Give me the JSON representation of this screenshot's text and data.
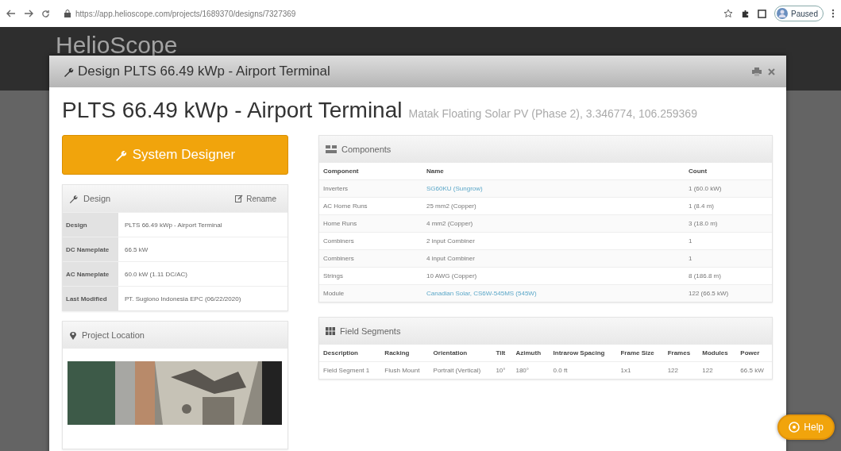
{
  "browser": {
    "url": "https://app.helioscope.com/projects/1689370/designs/7327369",
    "profile": "Paused"
  },
  "app_header": {
    "logo": "HelioScope"
  },
  "modal": {
    "title": "Design PLTS 66.49 kWp - Airport Terminal"
  },
  "heading": {
    "title": "PLTS 66.49 kWp - Airport Terminal",
    "subtitle": "Matak Floating Solar PV (Phase 2), 3.346774, 106.259369"
  },
  "system_designer_button": "System Designer",
  "design_panel": {
    "title": "Design",
    "rename_button": "Rename",
    "rows": [
      {
        "label": "Design",
        "value": "PLTS 66.49 kWp - Airport Terminal"
      },
      {
        "label": "DC Nameplate",
        "value": "66.5 kW"
      },
      {
        "label": "AC Nameplate",
        "value": "60.0 kW (1.11 DC/AC)"
      },
      {
        "label": "Last Modified",
        "value": "PT. Sugiono Indonesia EPC (06/22/2020)"
      }
    ]
  },
  "location_panel": {
    "title": "Project Location"
  },
  "components": {
    "title": "Components",
    "columns": [
      "Component",
      "Name",
      "Count"
    ],
    "rows": [
      {
        "component": "Inverters",
        "name": "SG60KU (Sungrow)",
        "link": true,
        "count": "1 (60.0 kW)"
      },
      {
        "component": "AC Home Runs",
        "name": "25 mm2 (Copper)",
        "link": false,
        "count": "1 (8.4 m)"
      },
      {
        "component": "Home Runs",
        "name": "4 mm2 (Copper)",
        "link": false,
        "count": "3 (18.0 m)"
      },
      {
        "component": "Combiners",
        "name": "2 input Combiner",
        "link": false,
        "count": "1"
      },
      {
        "component": "Combiners",
        "name": "4 input Combiner",
        "link": false,
        "count": "1"
      },
      {
        "component": "Strings",
        "name": "10 AWG (Copper)",
        "link": false,
        "count": "8 (186.8 m)"
      },
      {
        "component": "Module",
        "name": "Canadian Solar, CS6W-545MS (545W)",
        "link": true,
        "count": "122 (66.5 kW)"
      }
    ]
  },
  "field_segments": {
    "title": "Field Segments",
    "columns": [
      "Description",
      "Racking",
      "Orientation",
      "Tilt",
      "Azimuth",
      "Intrarow Spacing",
      "Frame Size",
      "Frames",
      "Modules",
      "Power"
    ],
    "rows": [
      [
        "Field Segment 1",
        "Flush Mount",
        "Portrait (Vertical)",
        "10°",
        "180°",
        "0.0 ft",
        "1x1",
        "122",
        "122",
        "66.5 kW"
      ]
    ]
  },
  "help_button": "Help"
}
